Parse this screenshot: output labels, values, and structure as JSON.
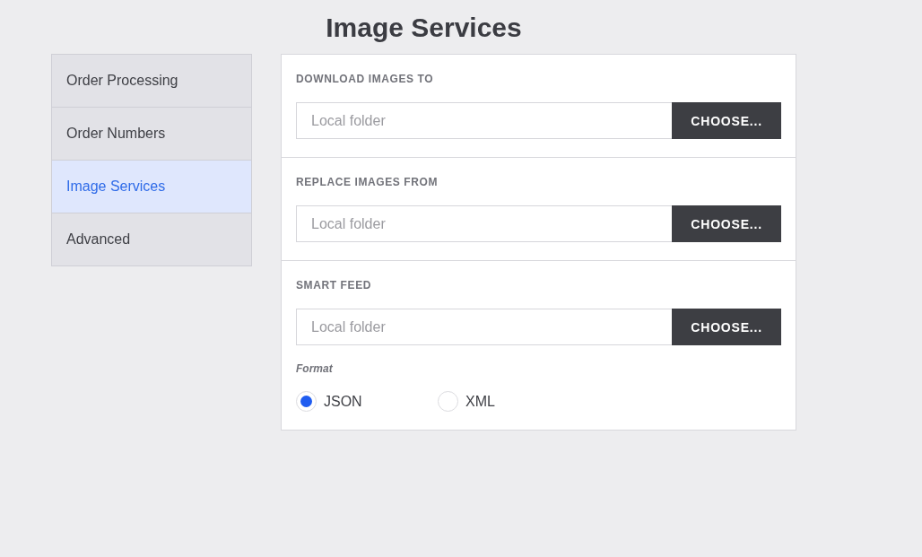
{
  "title": "Image Services",
  "sidebar": {
    "items": [
      {
        "label": "Order Processing",
        "selected": false
      },
      {
        "label": "Order Numbers",
        "selected": false
      },
      {
        "label": "Image Services",
        "selected": true
      },
      {
        "label": "Advanced",
        "selected": false
      }
    ]
  },
  "sections": [
    {
      "heading": "DOWNLOAD IMAGES TO",
      "placeholder": "Local folder",
      "button": "CHOOSE..."
    },
    {
      "heading": "REPLACE IMAGES FROM",
      "placeholder": "Local folder",
      "button": "CHOOSE..."
    },
    {
      "heading": "SMART FEED",
      "placeholder": "Local folder",
      "button": "CHOOSE...",
      "format": {
        "label": "Format",
        "options": [
          {
            "label": "JSON",
            "selected": true
          },
          {
            "label": "XML",
            "selected": false
          }
        ]
      }
    }
  ]
}
